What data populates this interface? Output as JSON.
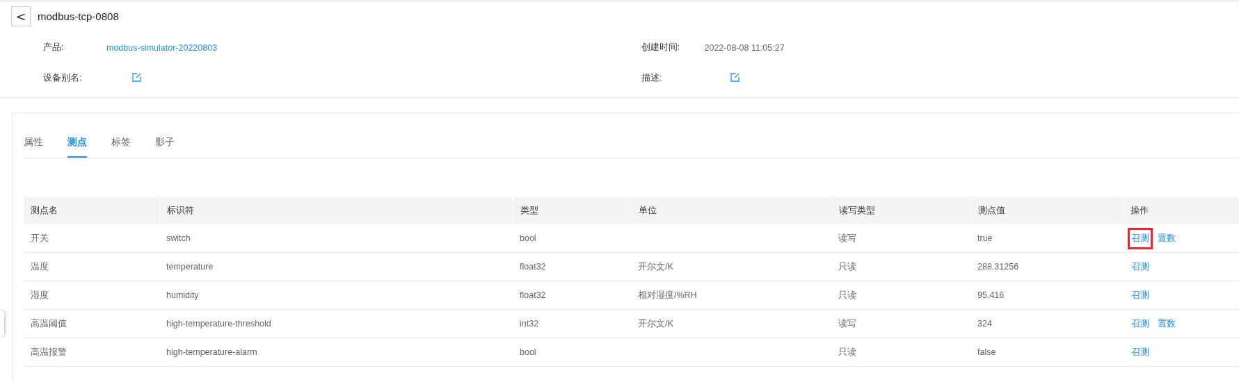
{
  "header": {
    "back": "<",
    "title": "modbus-tcp-0808"
  },
  "info": [
    {
      "label": "产品:",
      "value": "modbus-simulator-20220803",
      "kind": "link"
    },
    {
      "label": "创建时间:",
      "value": "2022-08-08 11:05:27",
      "kind": "text"
    },
    {
      "label": "设备别名:",
      "kind": "edit"
    },
    {
      "label": "描述:",
      "kind": "edit"
    }
  ],
  "tabs": [
    {
      "label": "属性",
      "selected": false
    },
    {
      "label": "测点",
      "selected": true
    },
    {
      "label": "标签",
      "selected": false
    },
    {
      "label": "影子",
      "selected": false
    }
  ],
  "table": {
    "columns": [
      "测点名",
      "标识符",
      "类型",
      "单位",
      "读写类型",
      "测点值",
      "操作"
    ],
    "rows": [
      {
        "cells": [
          "开关",
          "switch",
          "bool",
          "",
          "读写",
          "true"
        ],
        "actions": [
          {
            "label": "召测",
            "highlighted": true
          },
          {
            "label": "置数",
            "highlighted": false
          }
        ]
      },
      {
        "cells": [
          "温度",
          "temperature",
          "float32",
          "开尔文/K",
          "只读",
          "288.31256"
        ],
        "actions": [
          {
            "label": "召测",
            "highlighted": false
          }
        ]
      },
      {
        "cells": [
          "湿度",
          "humidity",
          "float32",
          "相对湿度/%RH",
          "只读",
          "95.416"
        ],
        "actions": [
          {
            "label": "召测",
            "highlighted": false
          }
        ]
      },
      {
        "cells": [
          "高温阈值",
          "high-temperature-threshold",
          "int32",
          "开尔文/K",
          "读写",
          "324"
        ],
        "actions": [
          {
            "label": "召测",
            "highlighted": false
          },
          {
            "label": "置数",
            "highlighted": false
          }
        ]
      },
      {
        "cells": [
          "高温报警",
          "high-temperature-alarm",
          "bool",
          "",
          "只读",
          "false"
        ],
        "actions": [
          {
            "label": "召测",
            "highlighted": false
          }
        ]
      }
    ]
  }
}
